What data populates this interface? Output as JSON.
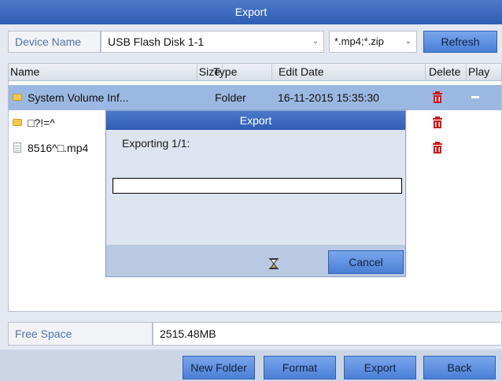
{
  "window": {
    "title": "Export"
  },
  "device": {
    "label": "Device Name",
    "value": "USB Flash Disk 1-1",
    "filter": "*.mp4;*.zip",
    "refresh": "Refresh"
  },
  "list": {
    "headers": [
      "Name",
      "Size",
      "Type",
      "Edit Date",
      "Delete",
      "Play"
    ],
    "rows": [
      {
        "name": "System Volume Inf...",
        "size": "",
        "type": "Folder",
        "date": "16-11-2015 15:35:30",
        "icon": "folder-icon",
        "selected": true
      },
      {
        "name": "□?!=^",
        "size": "",
        "type": "",
        "date": "",
        "icon": "folder-icon",
        "selected": false
      },
      {
        "name": "8516^□.mp4",
        "size": "",
        "type": "",
        "date": "",
        "icon": "file-icon",
        "selected": false
      }
    ]
  },
  "free_space": {
    "label": "Free Space",
    "value": "2515.48MB"
  },
  "buttons": {
    "new_folder": "New Folder",
    "format": "Format",
    "export": "Export",
    "back": "Back"
  },
  "dialog": {
    "title": "Export",
    "status": "Exporting 1/1:",
    "progress": 0,
    "cancel": "Cancel"
  },
  "colors": {
    "title_bar": "#2f5db4",
    "selected_row": "#9ab8e2",
    "delete_icon": "#d01818"
  }
}
